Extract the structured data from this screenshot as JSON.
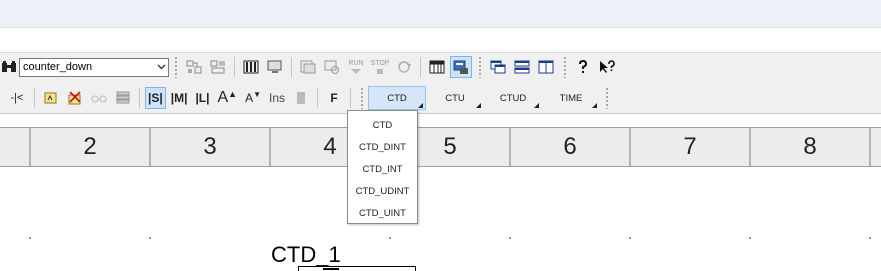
{
  "toolbar": {
    "pou_selector": {
      "value": "counter_down"
    },
    "row1_icons": [
      "binoculars-icon",
      "edit-props-icon",
      "edit-props-2-icon",
      "columns-icon",
      "monitor-icon",
      "network-1-icon",
      "network-2-icon",
      "run-icon",
      "stop-icon",
      "refresh-icon",
      "grid-view-icon",
      "watch-icon",
      "cascade-windows-icon",
      "tile-horizontal-icon",
      "tile-vertical-icon",
      "help-icon",
      "context-help-icon"
    ],
    "run_label": "RUN",
    "stop_label": "STOP",
    "row2": {
      "contact_symbol": "-|<",
      "set_label": "|S|",
      "m_label": "|M|",
      "l_label": "|L|",
      "font_larger": "A",
      "font_smaller": "A",
      "ins_label": "Ins",
      "f_label": "F"
    },
    "function_blocks": [
      {
        "label": "CTD",
        "active": true
      },
      {
        "label": "CTU",
        "active": false
      },
      {
        "label": "CTUD",
        "active": false
      },
      {
        "label": "TIME",
        "active": false
      }
    ]
  },
  "dropdown": {
    "options": [
      "CTD",
      "CTD_DINT",
      "CTD_INT",
      "CTD_UDINT",
      "CTD_UINT"
    ]
  },
  "ruler": {
    "columns": [
      "2",
      "3",
      "4",
      "5",
      "6",
      "7",
      "8"
    ]
  },
  "canvas": {
    "block_instance_name": "CTD_1"
  },
  "colors": {
    "toolbar_bg": "#f0f0f0",
    "pressed_bg": "#cce4f7",
    "ruler_bg": "#ececec"
  }
}
